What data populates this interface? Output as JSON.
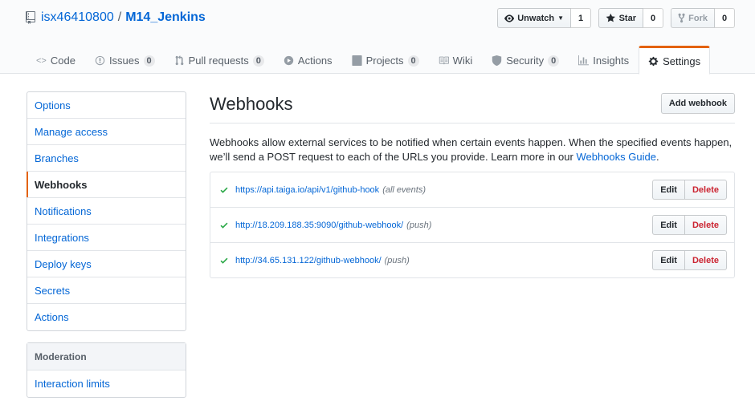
{
  "repo": {
    "owner": "isx46410800",
    "separator": "/",
    "name": "M14_Jenkins"
  },
  "actions": {
    "watch_label": "Unwatch",
    "watch_count": "1",
    "star_label": "Star",
    "star_count": "0",
    "fork_label": "Fork",
    "fork_count": "0"
  },
  "nav": {
    "code": "Code",
    "issues": "Issues",
    "issues_count": "0",
    "pulls": "Pull requests",
    "pulls_count": "0",
    "actions": "Actions",
    "projects": "Projects",
    "projects_count": "0",
    "wiki": "Wiki",
    "security": "Security",
    "security_count": "0",
    "insights": "Insights",
    "settings": "Settings"
  },
  "sidebar": {
    "items": [
      "Options",
      "Manage access",
      "Branches",
      "Webhooks",
      "Notifications",
      "Integrations",
      "Deploy keys",
      "Secrets",
      "Actions"
    ],
    "moderation_heading": "Moderation",
    "moderation_items": [
      "Interaction limits"
    ]
  },
  "main": {
    "title": "Webhooks",
    "add_button": "Add webhook",
    "description": "Webhooks allow external services to be notified when certain events happen. When the specified events happen, we’ll send a POST request to each of the URLs you provide. Learn more in our ",
    "guide_link": "Webhooks Guide",
    "description_end": "."
  },
  "hooks": [
    {
      "url": "https://api.taiga.io/api/v1/github-hook",
      "events": "(all events)"
    },
    {
      "url": "http://18.209.188.35:9090/github-webhook/",
      "events": "(push)"
    },
    {
      "url": "http://34.65.131.122/github-webhook/",
      "events": "(push)"
    }
  ],
  "hook_buttons": {
    "edit": "Edit",
    "delete": "Delete"
  },
  "colors": {
    "accent": "#e36209",
    "link": "#0366d6",
    "danger": "#cb2431",
    "success": "#28a745"
  }
}
